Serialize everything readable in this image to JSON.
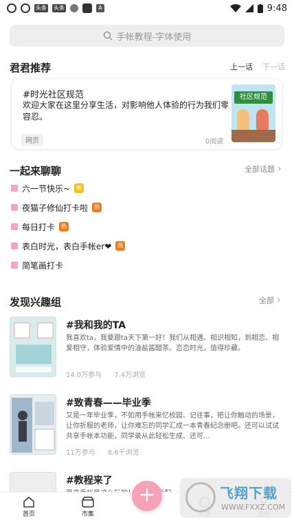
{
  "status_bar": {
    "time": "9:48",
    "icons": [
      "app-circle-icon",
      "app-circle-icon",
      "toutiao-icon",
      "toutiao-icon",
      "shield-icon",
      "app-square-icon",
      "a-icon",
      "wifi-icon",
      "signal-icon",
      "battery-icon"
    ],
    "tag_label_1": "头条",
    "tag_label_2": "头条",
    "a_label": "A"
  },
  "search": {
    "placeholder": "手帐教程-字体使用"
  },
  "recommend": {
    "title": "君君推荐",
    "prev": "上一话",
    "next": "下一话",
    "card": {
      "topic": "#时光社区规范",
      "body": "欢迎大家在这里分享生活，对影响他人体验的行为我们零容忍。",
      "tag": "网页",
      "reads": "0阅读",
      "thumb_banner": "社区规范"
    }
  },
  "chat": {
    "title": "一起来聊聊",
    "all_link": "全部话题",
    "topics": [
      {
        "label": "六一节快乐~",
        "badge": "新",
        "badge_type": "new"
      },
      {
        "label": "夜猫子修仙打卡啦",
        "badge": "热",
        "badge_type": "hot"
      },
      {
        "label": "每日打卡",
        "badge": "热",
        "badge_type": "hot"
      },
      {
        "label": "表白时光，表白手帐er❤",
        "badge": "热",
        "badge_type": "hot"
      },
      {
        "label": "简笔画打卡",
        "badge": "",
        "badge_type": ""
      }
    ]
  },
  "groups": {
    "title": "发现兴趣组",
    "all_link": "全部",
    "items": [
      {
        "title": "#我和我的TA",
        "desc": "我喜欢ta，我要跟ta天下第一好！我们从相遇、相识相知，到相恋、相爱相守，体验爱情中的油盐酱醋茶。恋恋时光，值得珍藏。",
        "participants": "14.0万参与",
        "views": "7.4万浏览"
      },
      {
        "title": "#致青春——毕业季",
        "desc": "又是一年毕业季，不如用手帐来忆校园、记往事，把让你触动的场景，让你折服的老师，让你难忘的同学汇成一本青春纪念册吧。还可以试试共享手帐本功能，同学录从此轻松生成、还可...",
        "participants": "11万参与",
        "views": "8.6千浏览"
      },
      {
        "title": "#教程来了",
        "desc": "愿来手帐是这么玩的！ 手帐的标配",
        "participants": "",
        "views": ""
      }
    ]
  },
  "bottom_nav": {
    "items": [
      {
        "label": "首页",
        "icon": "home-icon"
      },
      {
        "label": "市集",
        "icon": "market-icon"
      },
      {
        "label": "发现",
        "icon": "discover-icon"
      },
      {
        "label": "我的",
        "icon": "profile-icon"
      }
    ],
    "fab_label": "+"
  },
  "watermark": {
    "text": "飞翔下载",
    "url": "WWW.FXXZ.COM"
  }
}
